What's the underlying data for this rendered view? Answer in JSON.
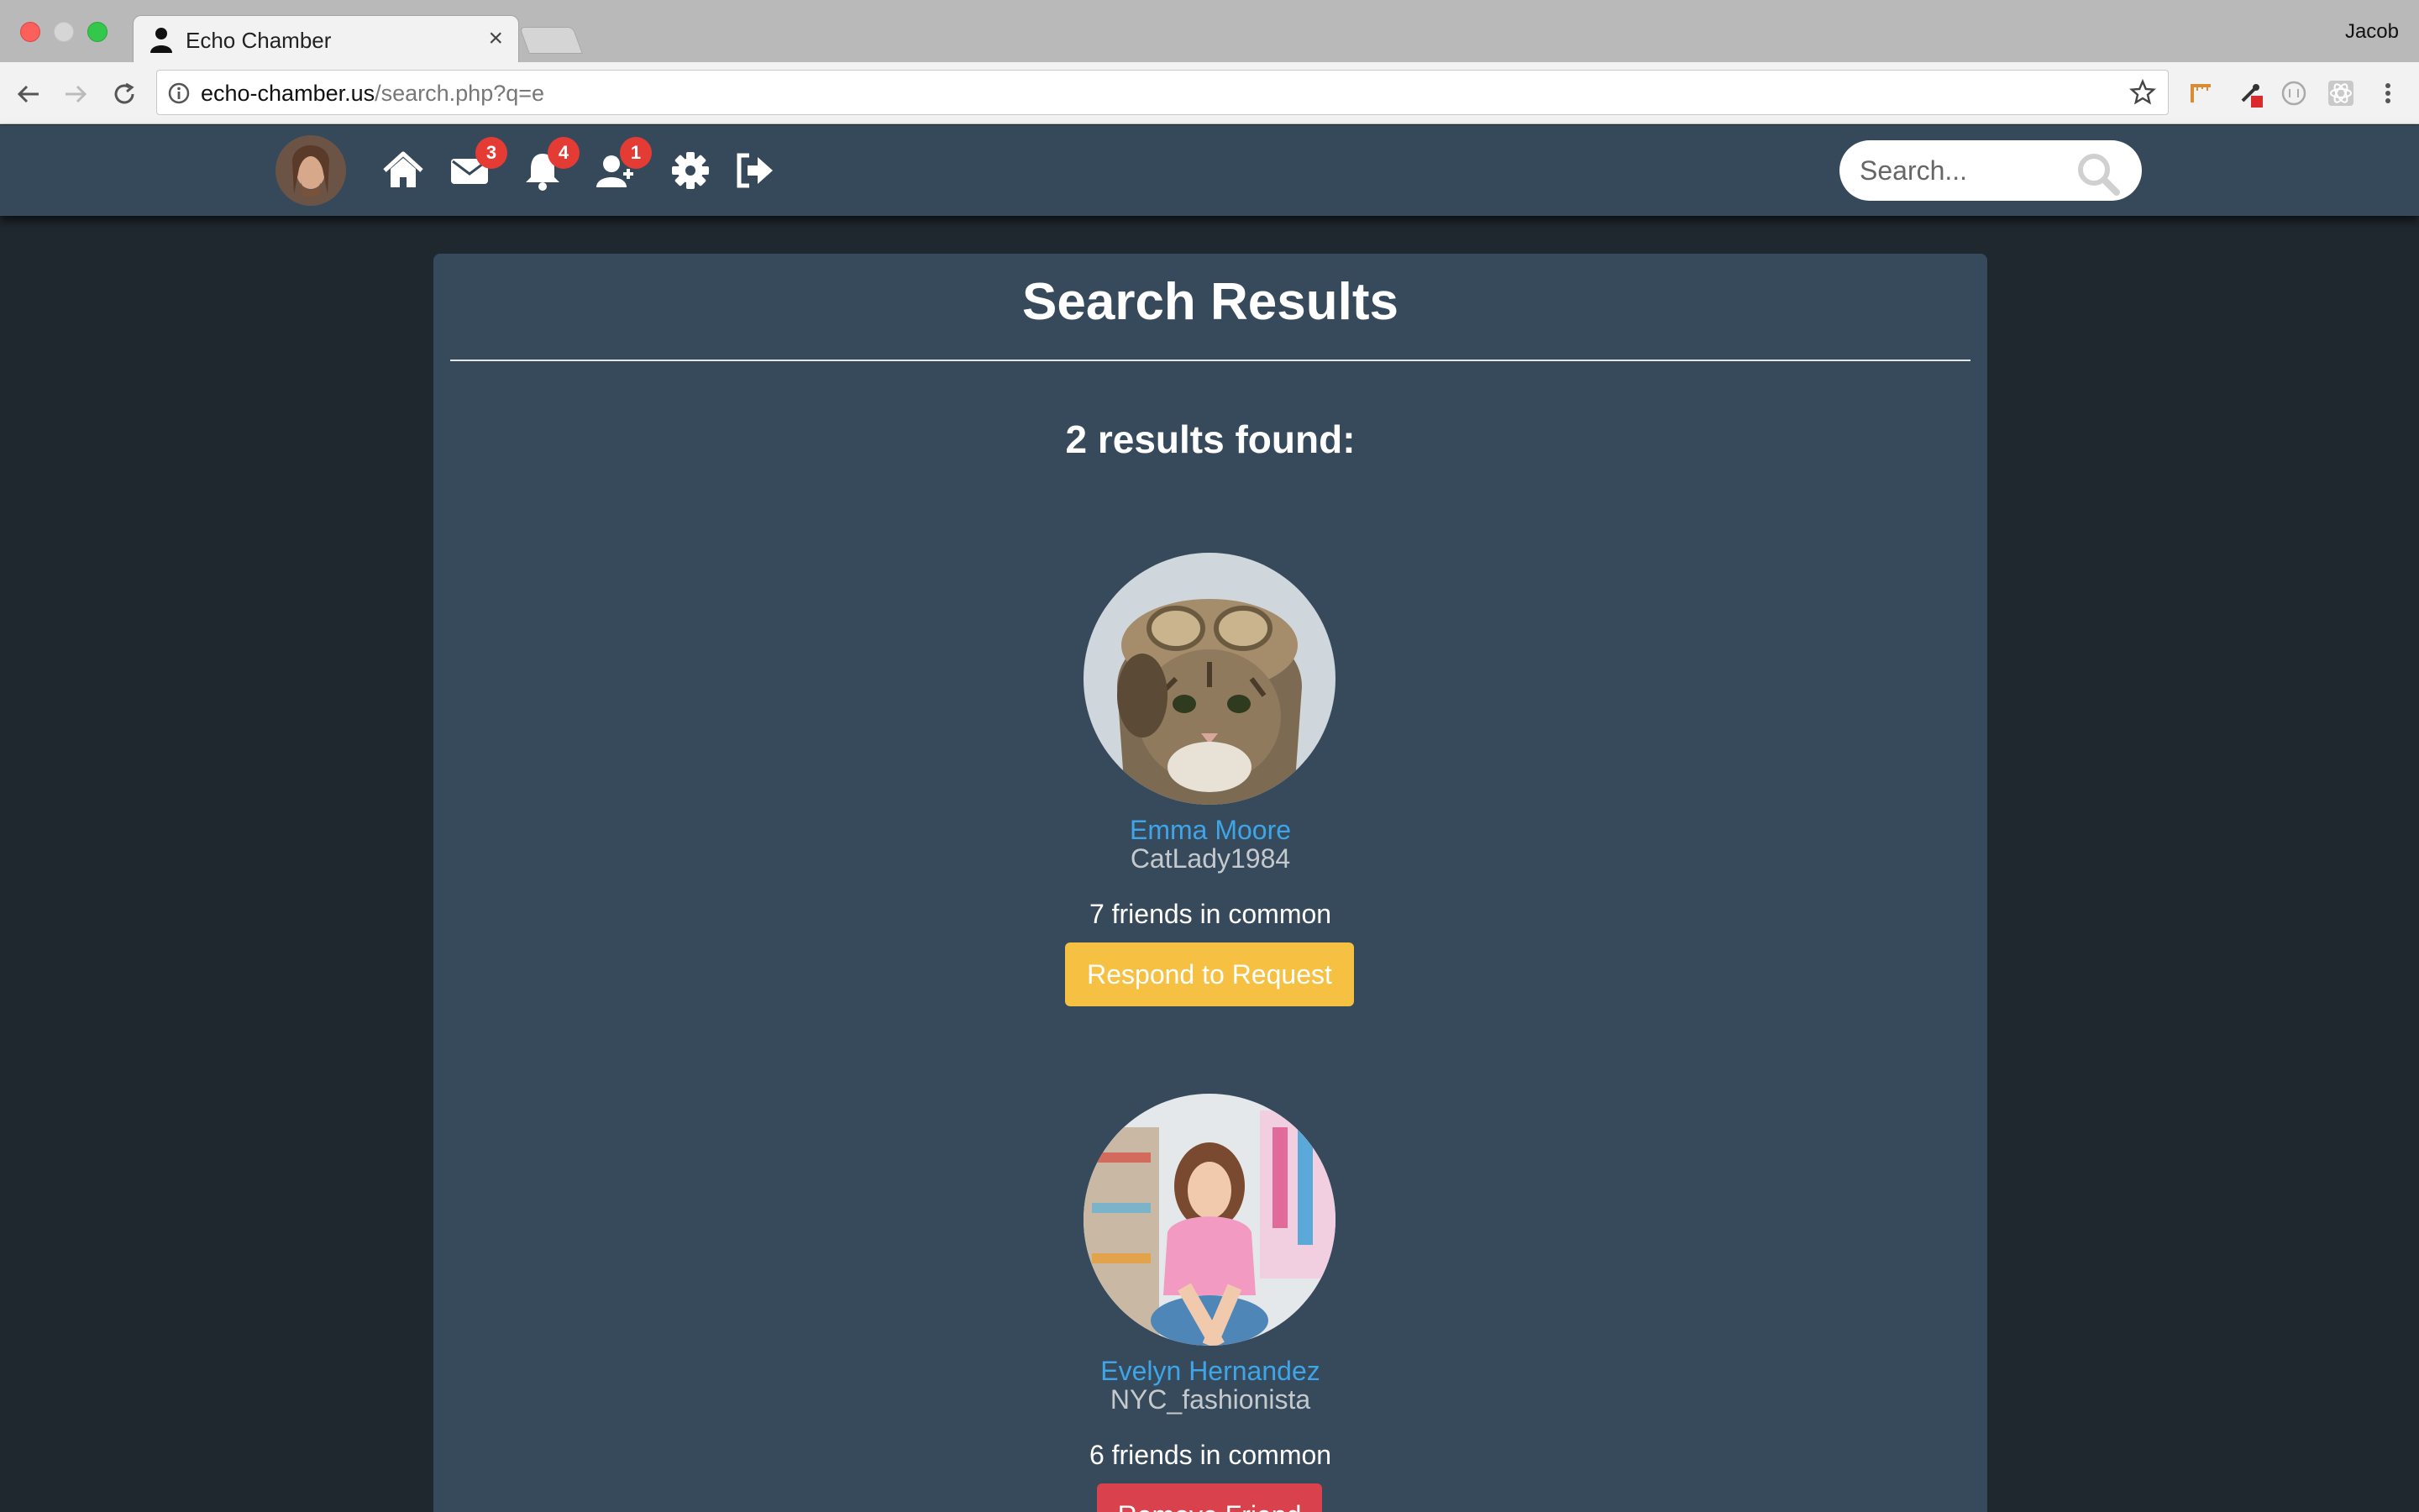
{
  "browser": {
    "tab_title": "Echo Chamber",
    "tab_close": "×",
    "profile_name": "Jacob",
    "url_host": "echo-chamber.us",
    "url_path": "/search.php?q=e"
  },
  "navbar": {
    "badges": {
      "messages": "3",
      "notifications": "4",
      "friend_requests": "1"
    },
    "search_placeholder": "Search..."
  },
  "main": {
    "title": "Search Results",
    "results_count": "2 results found:",
    "results": [
      {
        "name": "Emma Moore",
        "username": "CatLady1984",
        "common_friends": "7 friends in common",
        "action_label": "Respond to Request",
        "action_color": "#f6c042"
      },
      {
        "name": "Evelyn Hernandez",
        "username": "NYC_fashionista",
        "common_friends": "6 friends in common",
        "action_label": "Remove Friend",
        "action_color": "#d9414d"
      }
    ]
  },
  "colors": {
    "navbar_bg": "#36495b",
    "page_bg": "#1f272f",
    "panel_bg": "#374a5c",
    "link": "#3da5e8",
    "badge": "#e53b35"
  }
}
